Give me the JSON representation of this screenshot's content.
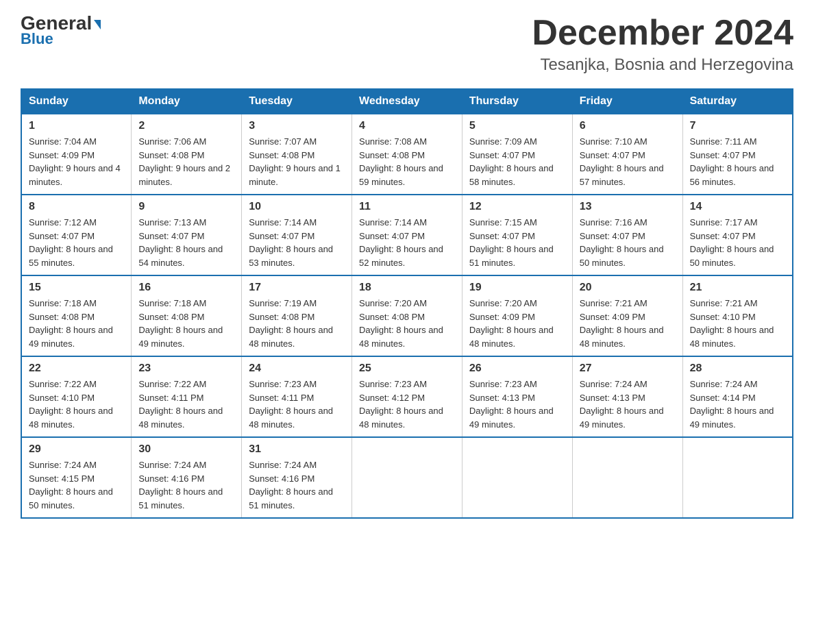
{
  "header": {
    "logo_general": "General",
    "logo_blue": "Blue",
    "month_title": "December 2024",
    "location": "Tesanjka, Bosnia and Herzegovina"
  },
  "days_of_week": [
    "Sunday",
    "Monday",
    "Tuesday",
    "Wednesday",
    "Thursday",
    "Friday",
    "Saturday"
  ],
  "weeks": [
    [
      {
        "day": "1",
        "sunrise": "7:04 AM",
        "sunset": "4:09 PM",
        "daylight": "9 hours and 4 minutes."
      },
      {
        "day": "2",
        "sunrise": "7:06 AM",
        "sunset": "4:08 PM",
        "daylight": "9 hours and 2 minutes."
      },
      {
        "day": "3",
        "sunrise": "7:07 AM",
        "sunset": "4:08 PM",
        "daylight": "9 hours and 1 minute."
      },
      {
        "day": "4",
        "sunrise": "7:08 AM",
        "sunset": "4:08 PM",
        "daylight": "8 hours and 59 minutes."
      },
      {
        "day": "5",
        "sunrise": "7:09 AM",
        "sunset": "4:07 PM",
        "daylight": "8 hours and 58 minutes."
      },
      {
        "day": "6",
        "sunrise": "7:10 AM",
        "sunset": "4:07 PM",
        "daylight": "8 hours and 57 minutes."
      },
      {
        "day": "7",
        "sunrise": "7:11 AM",
        "sunset": "4:07 PM",
        "daylight": "8 hours and 56 minutes."
      }
    ],
    [
      {
        "day": "8",
        "sunrise": "7:12 AM",
        "sunset": "4:07 PM",
        "daylight": "8 hours and 55 minutes."
      },
      {
        "day": "9",
        "sunrise": "7:13 AM",
        "sunset": "4:07 PM",
        "daylight": "8 hours and 54 minutes."
      },
      {
        "day": "10",
        "sunrise": "7:14 AM",
        "sunset": "4:07 PM",
        "daylight": "8 hours and 53 minutes."
      },
      {
        "day": "11",
        "sunrise": "7:14 AM",
        "sunset": "4:07 PM",
        "daylight": "8 hours and 52 minutes."
      },
      {
        "day": "12",
        "sunrise": "7:15 AM",
        "sunset": "4:07 PM",
        "daylight": "8 hours and 51 minutes."
      },
      {
        "day": "13",
        "sunrise": "7:16 AM",
        "sunset": "4:07 PM",
        "daylight": "8 hours and 50 minutes."
      },
      {
        "day": "14",
        "sunrise": "7:17 AM",
        "sunset": "4:07 PM",
        "daylight": "8 hours and 50 minutes."
      }
    ],
    [
      {
        "day": "15",
        "sunrise": "7:18 AM",
        "sunset": "4:08 PM",
        "daylight": "8 hours and 49 minutes."
      },
      {
        "day": "16",
        "sunrise": "7:18 AM",
        "sunset": "4:08 PM",
        "daylight": "8 hours and 49 minutes."
      },
      {
        "day": "17",
        "sunrise": "7:19 AM",
        "sunset": "4:08 PM",
        "daylight": "8 hours and 48 minutes."
      },
      {
        "day": "18",
        "sunrise": "7:20 AM",
        "sunset": "4:08 PM",
        "daylight": "8 hours and 48 minutes."
      },
      {
        "day": "19",
        "sunrise": "7:20 AM",
        "sunset": "4:09 PM",
        "daylight": "8 hours and 48 minutes."
      },
      {
        "day": "20",
        "sunrise": "7:21 AM",
        "sunset": "4:09 PM",
        "daylight": "8 hours and 48 minutes."
      },
      {
        "day": "21",
        "sunrise": "7:21 AM",
        "sunset": "4:10 PM",
        "daylight": "8 hours and 48 minutes."
      }
    ],
    [
      {
        "day": "22",
        "sunrise": "7:22 AM",
        "sunset": "4:10 PM",
        "daylight": "8 hours and 48 minutes."
      },
      {
        "day": "23",
        "sunrise": "7:22 AM",
        "sunset": "4:11 PM",
        "daylight": "8 hours and 48 minutes."
      },
      {
        "day": "24",
        "sunrise": "7:23 AM",
        "sunset": "4:11 PM",
        "daylight": "8 hours and 48 minutes."
      },
      {
        "day": "25",
        "sunrise": "7:23 AM",
        "sunset": "4:12 PM",
        "daylight": "8 hours and 48 minutes."
      },
      {
        "day": "26",
        "sunrise": "7:23 AM",
        "sunset": "4:13 PM",
        "daylight": "8 hours and 49 minutes."
      },
      {
        "day": "27",
        "sunrise": "7:24 AM",
        "sunset": "4:13 PM",
        "daylight": "8 hours and 49 minutes."
      },
      {
        "day": "28",
        "sunrise": "7:24 AM",
        "sunset": "4:14 PM",
        "daylight": "8 hours and 49 minutes."
      }
    ],
    [
      {
        "day": "29",
        "sunrise": "7:24 AM",
        "sunset": "4:15 PM",
        "daylight": "8 hours and 50 minutes."
      },
      {
        "day": "30",
        "sunrise": "7:24 AM",
        "sunset": "4:16 PM",
        "daylight": "8 hours and 51 minutes."
      },
      {
        "day": "31",
        "sunrise": "7:24 AM",
        "sunset": "4:16 PM",
        "daylight": "8 hours and 51 minutes."
      },
      null,
      null,
      null,
      null
    ]
  ]
}
